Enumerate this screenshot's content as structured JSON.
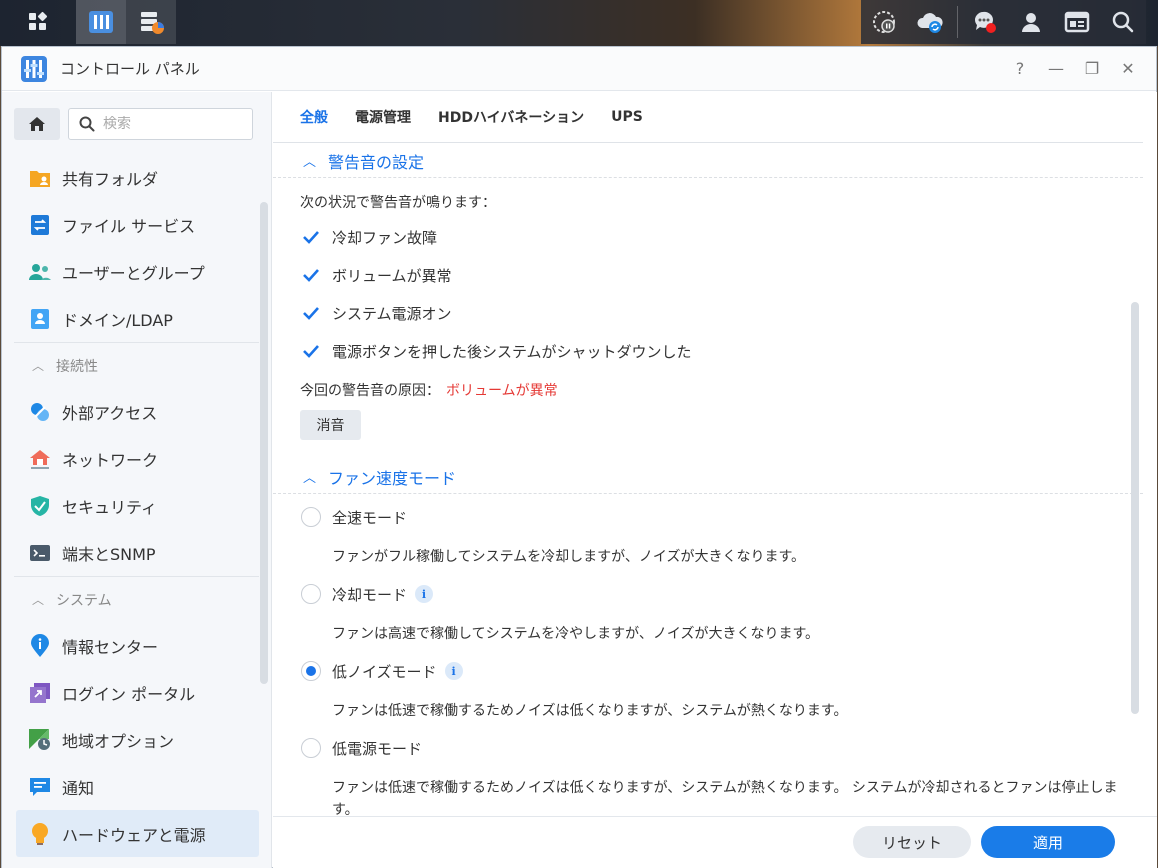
{
  "window": {
    "title": "コントロール パネル"
  },
  "window_controls": {
    "help": "?",
    "minimize": "—",
    "restore": "❐",
    "close": "✕"
  },
  "sidebar": {
    "search_placeholder": "検索",
    "items_top": [
      {
        "label": "共有フォルダ",
        "icon": "folder-icon"
      },
      {
        "label": "ファイル サービス",
        "icon": "file-service-icon"
      },
      {
        "label": "ユーザーとグループ",
        "icon": "users-icon"
      },
      {
        "label": "ドメイン/LDAP",
        "icon": "domain-icon"
      }
    ],
    "group_connectivity": "接続性",
    "items_connectivity": [
      {
        "label": "外部アクセス",
        "icon": "external-access-icon"
      },
      {
        "label": "ネットワーク",
        "icon": "network-icon"
      },
      {
        "label": "セキュリティ",
        "icon": "security-icon"
      },
      {
        "label": "端末とSNMP",
        "icon": "terminal-icon"
      }
    ],
    "group_system": "システム",
    "items_system": [
      {
        "label": "情報センター",
        "icon": "info-center-icon"
      },
      {
        "label": "ログイン ポータル",
        "icon": "login-portal-icon"
      },
      {
        "label": "地域オプション",
        "icon": "regional-icon"
      },
      {
        "label": "通知",
        "icon": "notification-icon"
      },
      {
        "label": "ハードウェアと電源",
        "icon": "hardware-power-icon"
      }
    ]
  },
  "tabs": [
    "全般",
    "電源管理",
    "HDDハイバネーション",
    "UPS"
  ],
  "beep": {
    "title": "警告音の設定",
    "desc": "次の状況で警告音が鳴ります：",
    "options": [
      "冷却ファン故障",
      "ボリュームが異常",
      "システム電源オン",
      "電源ボタンを押した後システムがシャットダウンした"
    ],
    "cause_label": "今回の警告音の原因：",
    "cause_value": "ボリュームが異常",
    "mute": "消音"
  },
  "fan": {
    "title": "ファン速度モード",
    "modes": [
      {
        "label": "全速モード",
        "desc": "ファンがフル稼働してシステムを冷却しますが、ノイズが大きくなります。"
      },
      {
        "label": "冷却モード",
        "desc": "ファンは高速で稼働してシステムを冷やしますが、ノイズが大きくなります。"
      },
      {
        "label": "低ノイズモード",
        "desc": "ファンは低速で稼働するためノイズは低くなりますが、システムが熱くなります。"
      },
      {
        "label": "低電源モード",
        "desc": "ファンは低速で稼働するためノイズは低くなりますが、システムが熱くなります。 システムが冷却されるとファンは停止します。"
      }
    ],
    "selected": "低ノイズモード"
  },
  "footer": {
    "reset": "リセット",
    "apply": "適用"
  },
  "colors": {
    "accent": "#1a73e8",
    "alert": "#e53935"
  }
}
